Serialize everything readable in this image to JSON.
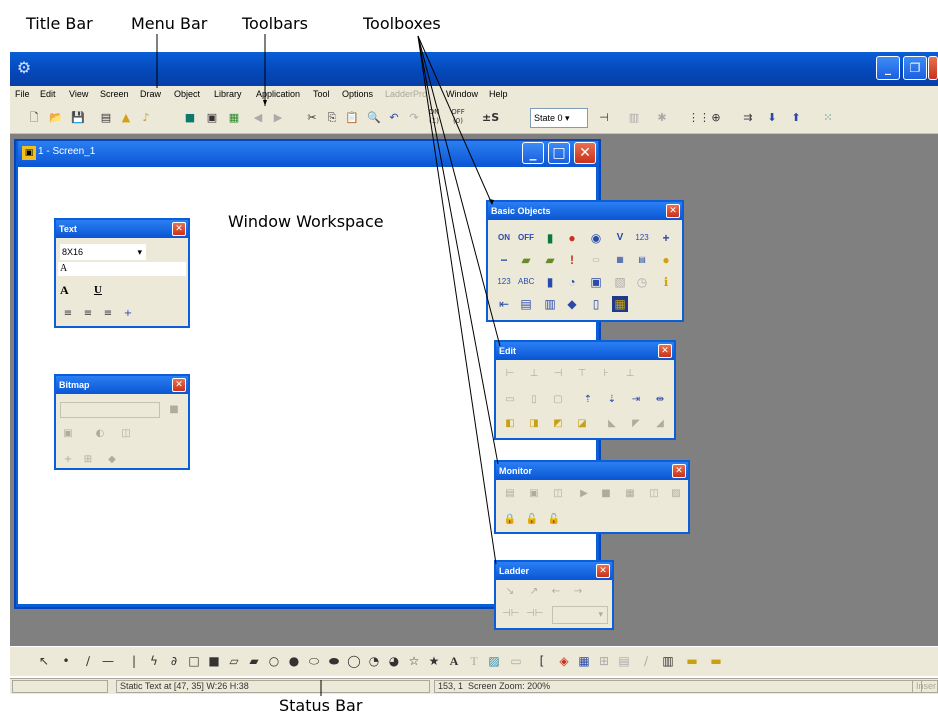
{
  "annotations": {
    "title_bar": "Title Bar",
    "menu_bar": "Menu Bar",
    "toolbars": "Toolbars",
    "toolboxes": "Toolboxes",
    "window_workspace": "Window Workspace",
    "status_bar": "Status Bar"
  },
  "menu": [
    "File",
    "Edit",
    "View",
    "Screen",
    "Draw",
    "Object",
    "Library",
    "Application",
    "Tool",
    "Options",
    "LadderPro",
    "Window",
    "Help"
  ],
  "toolbar": {
    "state_label": "State",
    "state_value": "0",
    "onoff_on": "ON (1)",
    "onoff_off": "OFF (0)"
  },
  "screen_window": {
    "title": "1 - Screen_1"
  },
  "text_box": {
    "title": "Text",
    "font_value": "8X16",
    "sample": "A",
    "bold": "A",
    "underline": "U"
  },
  "bitmap_box": {
    "title": "Bitmap"
  },
  "basic_objects": {
    "title": "Basic Objects",
    "labels": [
      "ON",
      "OFF",
      "V",
      "123",
      "ABC",
      "123",
      "ABC"
    ]
  },
  "edit_box": {
    "title": "Edit"
  },
  "monitor_box": {
    "title": "Monitor"
  },
  "ladder_box": {
    "title": "Ladder"
  },
  "status": {
    "object_info": "Static Text  at [47, 35] W:26 H:38",
    "coords": "153, 1",
    "zoom": "Screen Zoom: 200%",
    "mode": "Inser"
  },
  "colors": {
    "title_blue": "#0a5ed8",
    "face": "#ece9d8",
    "workspace": "#808080",
    "close_red": "#d84a2c"
  }
}
